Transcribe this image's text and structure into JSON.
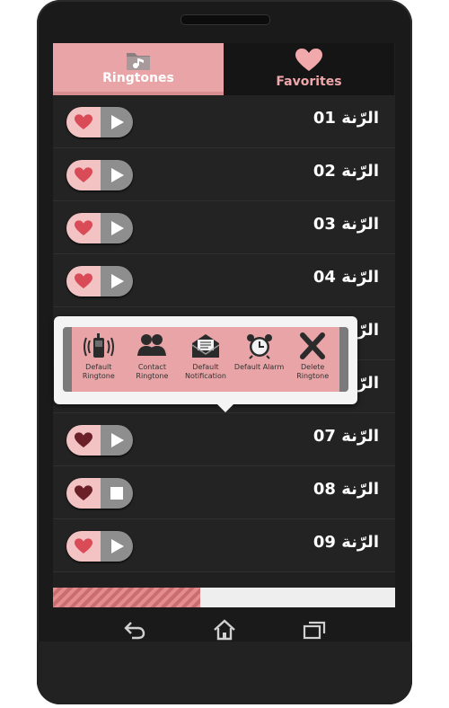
{
  "tabs": [
    {
      "label": "Ringtones",
      "icon": "folder-music-icon",
      "active": true
    },
    {
      "label": "Favorites",
      "icon": "heart-icon",
      "active": false
    }
  ],
  "ringtones": [
    {
      "title": "الرّنة 01",
      "favorite": true,
      "playing": false
    },
    {
      "title": "الرّنة 02",
      "favorite": true,
      "playing": false
    },
    {
      "title": "الرّنة 03",
      "favorite": true,
      "playing": false
    },
    {
      "title": "الرّنة 04",
      "favorite": true,
      "playing": false
    },
    {
      "title": "الرّنة 05",
      "favorite": true,
      "playing": false
    },
    {
      "title": "الرّنة 06",
      "favorite": true,
      "playing": false
    },
    {
      "title": "الرّنة 07",
      "favorite": false,
      "playing": false
    },
    {
      "title": "الرّنة 08",
      "favorite": false,
      "playing": true
    },
    {
      "title": "الرّنة 09",
      "favorite": true,
      "playing": false
    }
  ],
  "popup_menu": [
    {
      "label": "Default Ringtone",
      "icon": "phone-ring-icon"
    },
    {
      "label": "Contact Ringtone",
      "icon": "contacts-icon"
    },
    {
      "label": "Default Notification",
      "icon": "mail-icon"
    },
    {
      "label": "Default Alarm",
      "icon": "alarm-clock-icon"
    },
    {
      "label": "Delete Ringtone",
      "icon": "close-icon"
    }
  ],
  "scroll_progress": 0.43,
  "navigation": [
    "back-icon",
    "home-icon",
    "recent-apps-icon"
  ],
  "colors": {
    "accent": "#e8a4a6",
    "background": "#202020",
    "favorite_tab_text": "#efa7aa",
    "heart": "#d94b56"
  }
}
